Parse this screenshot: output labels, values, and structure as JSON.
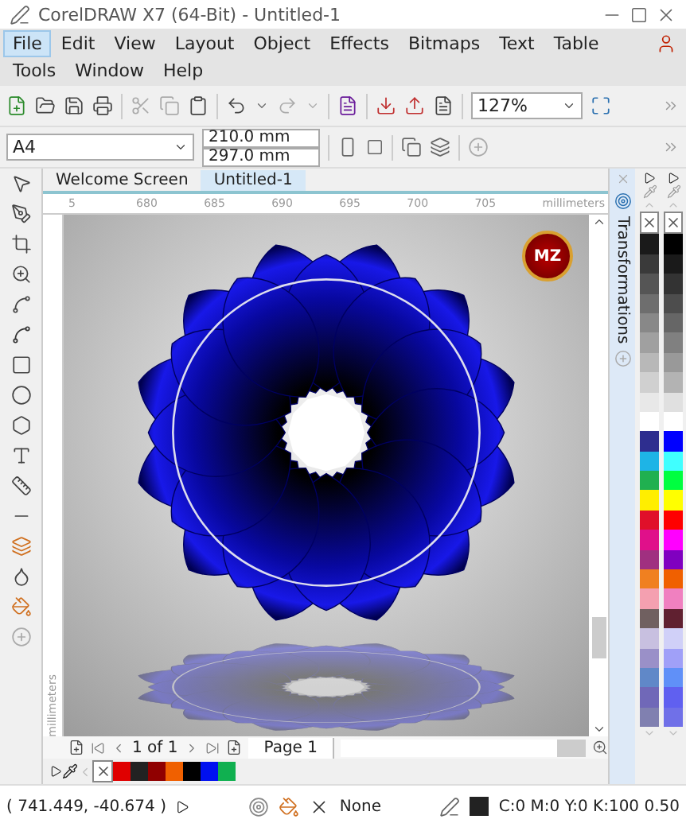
{
  "window": {
    "title": "CorelDRAW X7 (64-Bit) - Untitled-1"
  },
  "menu": [
    {
      "label": "File",
      "selected": true
    },
    {
      "label": "Edit",
      "selected": false
    },
    {
      "label": "View",
      "selected": false
    },
    {
      "label": "Layout",
      "selected": false
    },
    {
      "label": "Object",
      "selected": false
    },
    {
      "label": "Effects",
      "selected": false
    },
    {
      "label": "Bitmaps",
      "selected": false
    },
    {
      "label": "Text",
      "selected": false
    },
    {
      "label": "Table",
      "selected": false
    },
    {
      "label": "Tools",
      "selected": false
    },
    {
      "label": "Window",
      "selected": false
    },
    {
      "label": "Help",
      "selected": false
    }
  ],
  "toolbar": {
    "zoom": "127%"
  },
  "property_bar": {
    "page_size": "A4",
    "width": "210.0 mm",
    "height": "297.0 mm"
  },
  "doc_tabs": [
    {
      "label": "Welcome Screen",
      "selected": false
    },
    {
      "label": "Untitled-1",
      "selected": true
    }
  ],
  "ruler": {
    "ticks": [
      "5",
      "680",
      "685",
      "690",
      "695",
      "700",
      "705"
    ],
    "unit": "millimeters"
  },
  "vertical_ruler": {
    "unit": "millimeters"
  },
  "logo": {
    "text": "MZ"
  },
  "docker": {
    "label": "Transformations"
  },
  "palette_columns": [
    [
      {
        "kind": "none"
      },
      {
        "kind": "swatch",
        "color": "#1a1a1a"
      },
      {
        "kind": "swatch",
        "color": "#3a3a3a"
      },
      {
        "kind": "swatch",
        "color": "#555555"
      },
      {
        "kind": "swatch",
        "color": "#6e6e6e"
      },
      {
        "kind": "swatch",
        "color": "#888888"
      },
      {
        "kind": "swatch",
        "color": "#a0a0a0"
      },
      {
        "kind": "swatch",
        "color": "#b8b8b8"
      },
      {
        "kind": "swatch",
        "color": "#d0d0d0"
      },
      {
        "kind": "swatch",
        "color": "#e8e8e8"
      },
      {
        "kind": "swatch",
        "color": "#ffffff"
      },
      {
        "kind": "swatch",
        "color": "#2e2e8f"
      },
      {
        "kind": "swatch",
        "color": "#1eb4e6"
      },
      {
        "kind": "swatch",
        "color": "#20b050"
      },
      {
        "kind": "swatch",
        "color": "#ffee00"
      },
      {
        "kind": "swatch",
        "color": "#e0102a"
      },
      {
        "kind": "swatch",
        "color": "#e0108a"
      },
      {
        "kind": "swatch",
        "color": "#a03080"
      },
      {
        "kind": "swatch",
        "color": "#f08020"
      },
      {
        "kind": "swatch",
        "color": "#f4a0b0"
      },
      {
        "kind": "swatch",
        "color": "#706060"
      },
      {
        "kind": "swatch",
        "color": "#c8c0e0"
      },
      {
        "kind": "swatch",
        "color": "#9a90c8"
      },
      {
        "kind": "swatch",
        "color": "#6088c8"
      },
      {
        "kind": "swatch",
        "color": "#7068b8"
      },
      {
        "kind": "swatch",
        "color": "#8080b0"
      }
    ],
    [
      {
        "kind": "none"
      },
      {
        "kind": "swatch",
        "color": "#000000"
      },
      {
        "kind": "swatch",
        "color": "#1a1a1a"
      },
      {
        "kind": "swatch",
        "color": "#333333"
      },
      {
        "kind": "swatch",
        "color": "#4d4d4d"
      },
      {
        "kind": "swatch",
        "color": "#666666"
      },
      {
        "kind": "swatch",
        "color": "#808080"
      },
      {
        "kind": "swatch",
        "color": "#999999"
      },
      {
        "kind": "swatch",
        "color": "#b3b3b3"
      },
      {
        "kind": "swatch",
        "color": "#e0e0e0"
      },
      {
        "kind": "swatch",
        "color": "#ffffff"
      },
      {
        "kind": "swatch",
        "color": "#0000ff"
      },
      {
        "kind": "swatch",
        "color": "#40ffff"
      },
      {
        "kind": "swatch",
        "color": "#00ff40"
      },
      {
        "kind": "swatch",
        "color": "#ffff00"
      },
      {
        "kind": "swatch",
        "color": "#ff0000"
      },
      {
        "kind": "swatch",
        "color": "#ff00ff"
      },
      {
        "kind": "swatch",
        "color": "#8000c0"
      },
      {
        "kind": "swatch",
        "color": "#f06000"
      },
      {
        "kind": "swatch",
        "color": "#f080c0"
      },
      {
        "kind": "swatch",
        "color": "#602030"
      },
      {
        "kind": "swatch",
        "color": "#d0d0f8"
      },
      {
        "kind": "swatch",
        "color": "#a0a0f8"
      },
      {
        "kind": "swatch",
        "color": "#6090f8"
      },
      {
        "kind": "swatch",
        "color": "#6060f0"
      },
      {
        "kind": "swatch",
        "color": "#7070e8"
      }
    ]
  ],
  "page_nav": {
    "counter": "1 of 1",
    "page_tab": "Page 1"
  },
  "document_palette": [
    {
      "kind": "none"
    },
    {
      "kind": "swatch",
      "color": "#e00000"
    },
    {
      "kind": "swatch",
      "color": "#222222"
    },
    {
      "kind": "swatch",
      "color": "#900000"
    },
    {
      "kind": "swatch",
      "color": "#f06000"
    },
    {
      "kind": "swatch",
      "color": "#000000"
    },
    {
      "kind": "swatch",
      "color": "#0010f0"
    },
    {
      "kind": "swatch",
      "color": "#10b050"
    }
  ],
  "status": {
    "coords": "( 741.449, -40.674 )",
    "fill": "None",
    "outline": "C:0 M:0 Y:0 K:100 0.50"
  }
}
